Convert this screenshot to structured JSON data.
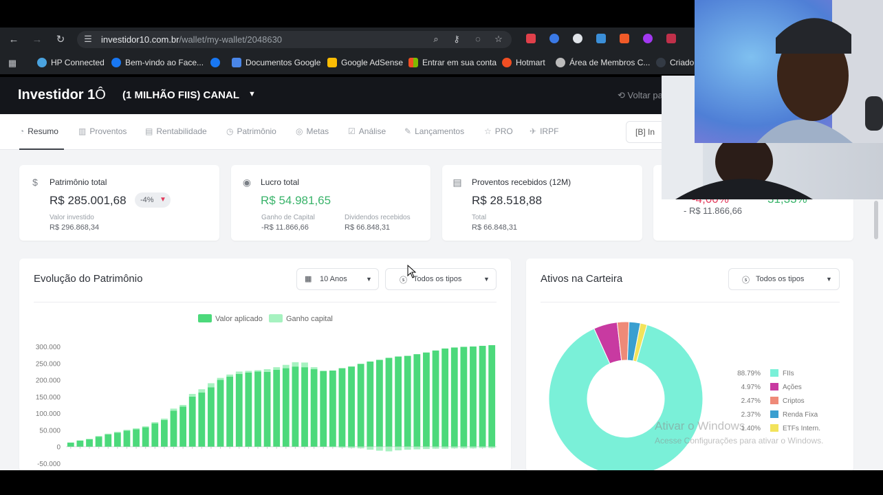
{
  "browser": {
    "url_host": "investidor10.com.br",
    "url_path": "/wallet/my-wallet/2048630",
    "bookmarks": [
      {
        "label": "HP Connected",
        "color": "#4aa3df"
      },
      {
        "label": "Bem-vindo ao Face...",
        "color": "#1877f2"
      },
      {
        "label": "",
        "color": "#1877f2"
      },
      {
        "label": "Documentos Google",
        "color": "#4a86e8"
      },
      {
        "label": "Google AdSense",
        "color": "#fbbc04"
      },
      {
        "label": "Entrar em sua conta",
        "color": "#f25022"
      },
      {
        "label": "Hotmart",
        "color": "#f04e23"
      },
      {
        "label": "Área de Membros C...",
        "color": "#bbbbbb"
      },
      {
        "label": "Criador",
        "color": "#333a44"
      }
    ]
  },
  "header": {
    "logo": "Investidor 1",
    "wallet_name": "(1 MILHÃO FIIS) CANAL",
    "voltar": "Voltar pa"
  },
  "tabs": [
    {
      "label": "Resumo",
      "icon": "gauge-icon",
      "glyph": "◔",
      "active": true
    },
    {
      "label": "Proventos",
      "icon": "building-icon",
      "glyph": "▥",
      "active": false
    },
    {
      "label": "Rentabilidade",
      "icon": "chart-icon",
      "glyph": "▤",
      "active": false
    },
    {
      "label": "Patrimônio",
      "icon": "clock-icon",
      "glyph": "◷",
      "active": false
    },
    {
      "label": "Metas",
      "icon": "target-icon",
      "glyph": "◎",
      "active": false
    },
    {
      "label": "Análise",
      "icon": "check-icon",
      "glyph": "☑",
      "active": false
    },
    {
      "label": "Lançamentos",
      "icon": "edit-icon",
      "glyph": "✎",
      "active": false
    },
    {
      "label": "PRO",
      "icon": "star-icon",
      "glyph": "☆",
      "active": false
    },
    {
      "label": "IRPF",
      "icon": "plane-icon",
      "glyph": "✈",
      "active": false
    }
  ],
  "ir_button": "[B]  In",
  "kpis": {
    "patrimonio": {
      "title": "Patrimônio total",
      "value": "R$ 285.001,68",
      "badge": "-4%",
      "sub_label": "Valor investido",
      "sub_value": "R$ 296.868,34"
    },
    "lucro": {
      "title": "Lucro total",
      "value": "R$ 54.981,65",
      "sub1_label": "Ganho de Capital",
      "sub1_value": "-R$ 11.866,66",
      "sub2_label": "Dividendos recebidos",
      "sub2_value": "R$ 66.848,31"
    },
    "proventos": {
      "title": "Proventos recebidos (12M)",
      "value": "R$ 28.518,88",
      "sub_label": "Total",
      "sub_value": "R$ 66.848,31"
    },
    "fourth": {
      "partial_left": "-4,00%",
      "partial_right": "31,33%",
      "sub_value": "- R$ 11.866,66"
    }
  },
  "evolucao": {
    "title": "Evolução do Patrimônio",
    "period": "10 Anos",
    "types": "Todos os tipos"
  },
  "ativos": {
    "title": "Ativos na Carteira",
    "types": "Todos os tipos"
  },
  "watermark": {
    "line1": "Ativar o Windows",
    "line2": "Acesse Configurações para ativar o Windows."
  },
  "chart_data": [
    {
      "type": "bar",
      "stacked": true,
      "legend": [
        "Valor aplicado",
        "Ganho capital"
      ],
      "legend_position": "top",
      "colors": {
        "Valor aplicado": "#4cd97b",
        "Ganho capital": "#a6f2c0"
      },
      "y_ticks": [
        "300.000",
        "250.000",
        "200.000",
        "150.000",
        "100.000",
        "50.000",
        "0",
        "-50.000"
      ],
      "ylim": [
        -50000,
        300000
      ],
      "grid": false,
      "series": [
        {
          "name": "Valor aplicado",
          "values": [
            12000,
            18000,
            22000,
            30000,
            37000,
            42000,
            48000,
            52000,
            58000,
            70000,
            80000,
            108000,
            120000,
            150000,
            162000,
            178000,
            200000,
            210000,
            218000,
            222000,
            225000,
            224000,
            230000,
            235000,
            240000,
            238000,
            232000,
            226000,
            228000,
            235000,
            240000,
            248000,
            255000,
            260000,
            266000,
            270000,
            272000,
            277000,
            282000,
            288000,
            294000,
            297000,
            299000,
            300000,
            302000,
            304000
          ]
        },
        {
          "name": "Ganho capital",
          "values": [
            1000,
            1000,
            1500,
            2000,
            2000,
            2500,
            2500,
            3000,
            3000,
            3500,
            4000,
            6000,
            5000,
            8000,
            10000,
            12000,
            6000,
            6000,
            7000,
            5000,
            4000,
            8000,
            8000,
            10000,
            13000,
            14000,
            6000,
            2000,
            -1500,
            -3000,
            -4000,
            -5000,
            -9000,
            -12000,
            -14000,
            -11000,
            -9000,
            -8000,
            -7000,
            -6000,
            -6000,
            -5000,
            -5000,
            -5000,
            -4000,
            -4000
          ]
        }
      ]
    },
    {
      "type": "pie",
      "donut": true,
      "labels": [
        "FIIs",
        "Ações",
        "Criptos",
        "Renda Fixa",
        "ETFs Intern."
      ],
      "values": [
        88.79,
        4.97,
        2.47,
        2.37,
        1.4
      ],
      "display": [
        "88.79%",
        "4.97%",
        "2.47%",
        "2.37%",
        "1.40%"
      ],
      "colors": [
        "#7af0d8",
        "#c83aa1",
        "#ef8a78",
        "#3a9fd0",
        "#f2e35b"
      ]
    }
  ]
}
